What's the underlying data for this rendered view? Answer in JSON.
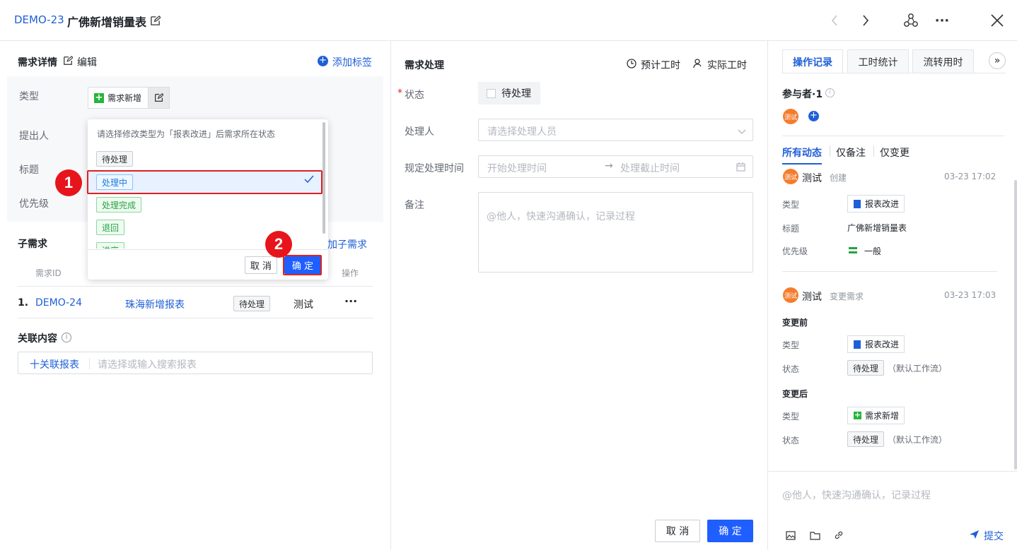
{
  "header": {
    "id": "DEMO-23",
    "title": "广佛新增销量表"
  },
  "left": {
    "section_title": "需求详情",
    "edit_label": "编辑",
    "add_tag": "添加标签",
    "fields": {
      "type": "类型",
      "proposer": "提出人",
      "title": "标题",
      "priority": "优先级"
    },
    "type_value": "需求新增",
    "dropdown": {
      "hint": "请选择修改类型为「报表改进」后需求所在状态",
      "options": [
        "待处理",
        "处理中",
        "处理完成",
        "退回",
        "进度"
      ],
      "cancel": "取 消",
      "confirm": "确 定"
    },
    "sub": {
      "title": "子需求",
      "add": "加子需求",
      "col_id": "需求ID",
      "col_op": "操作",
      "row": {
        "index": "1.",
        "id": "DEMO-24",
        "name": "珠海新增报表",
        "status": "待处理",
        "user": "测试",
        "more": "···"
      }
    },
    "related": {
      "title": "关联内容",
      "add": "十关联报表",
      "placeholder": "请选择或输入搜索报表"
    },
    "badges": [
      "1",
      "2"
    ]
  },
  "middle": {
    "title": "需求处理",
    "estimate": "预计工时",
    "actual": "实际工时",
    "status_label": "状态",
    "status_value": "待处理",
    "handler_label": "处理人",
    "handler_placeholder": "请选择处理人员",
    "time_label": "规定处理时间",
    "start_placeholder": "开始处理时间",
    "end_placeholder": "处理截止时间",
    "remark_label": "备注",
    "remark_placeholder": "@他人，快速沟通确认，记录过程",
    "cancel": "取 消",
    "confirm": "确 定"
  },
  "right": {
    "tabs": [
      "操作记录",
      "工时统计",
      "流转用时"
    ],
    "participants": "参与者·1",
    "avatar_text": "测试",
    "filters": [
      "所有动态",
      "仅备注",
      "仅变更"
    ],
    "log1": {
      "user": "测试",
      "action": "创建",
      "time": "03-23 17:02",
      "type_label": "类型",
      "type_value": "报表改进",
      "title_label": "标题",
      "title_value": "广佛新增销量表",
      "priority_label": "优先级",
      "priority_value": "一般"
    },
    "log2": {
      "user": "测试",
      "action": "变更需求",
      "time": "03-23 17:03",
      "before": "变更前",
      "after": "变更后",
      "type_label": "类型",
      "status_label": "状态",
      "before_type": "报表改进",
      "before_status": "待处理",
      "after_type": "需求新增",
      "after_status": "待处理",
      "flow": "（默认工作流）"
    },
    "comment_placeholder": "@他人，快速沟通确认，记录过程",
    "submit": "提交"
  }
}
